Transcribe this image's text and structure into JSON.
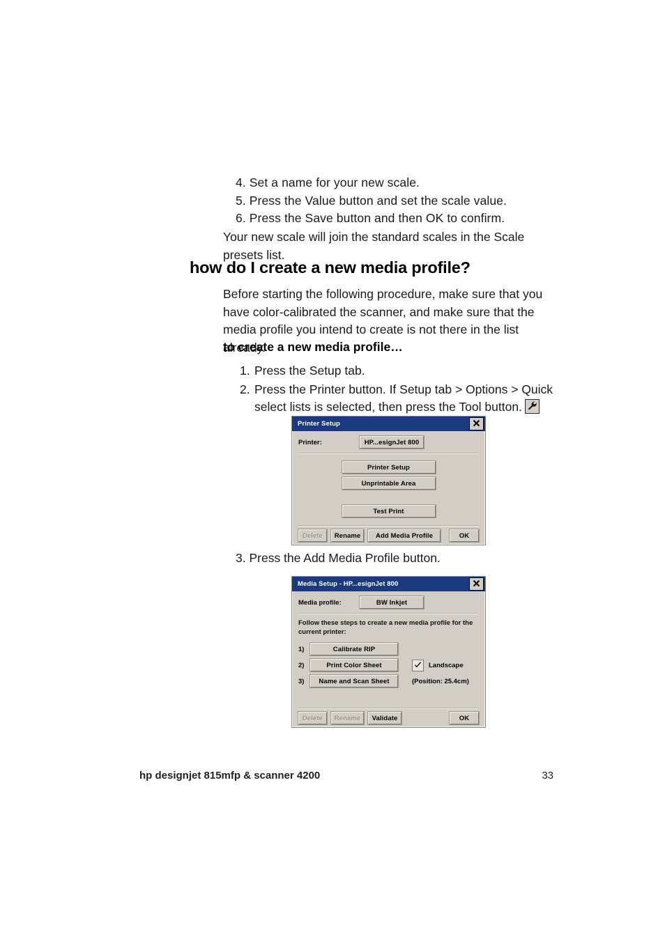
{
  "document": {
    "steps_top": [
      "4. Set a name for your new scale.",
      "5. Press the Value button and set the scale value.",
      "6. Press the Save button and then OK to confirm."
    ],
    "follow_up": "Your new scale will join the standard scales in the Scale presets list.",
    "heading": "how do I create a new media profile?",
    "intro": "Before starting the following procedure, make sure that you have color-calibrated the scanner, and make sure that the media profile you intend to create is not there in the list already.",
    "subheading": "to create a new media profile…",
    "step1_num": "1.",
    "step1_text": "Press the Setup tab.",
    "step2_num": "2.",
    "step2_text": "Press the Printer button. If Setup tab > Options > Quick select lists is selected, then press the Tool button.",
    "tool_icon": "wrench-icon",
    "step3": "3. Press the Add Media Profile button."
  },
  "printer_dialog": {
    "title": "Printer Setup",
    "close_icon": "close-icon",
    "printer_label": "Printer:",
    "printer_value": "HP...esignJet 800",
    "buttons": {
      "printer_setup": "Printer Setup",
      "unprintable_area": "Unprintable Area",
      "test_print": "Test Print",
      "delete": "Delete",
      "rename": "Rename",
      "add_media_profile": "Add Media Profile",
      "ok": "OK"
    }
  },
  "media_dialog": {
    "title": "Media Setup - HP...esignJet 800",
    "close_icon": "close-icon",
    "profile_label": "Media profile:",
    "profile_value": "BW Inkjet",
    "instructions": "Follow these steps to create a new media profile for the current printer:",
    "steps": [
      {
        "num": "1)",
        "label": "Calibrate RIP"
      },
      {
        "num": "2)",
        "label": "Print Color Sheet"
      },
      {
        "num": "3)",
        "label": "Name and Scan Sheet"
      }
    ],
    "landscape_label": "Landscape",
    "landscape_checked": true,
    "position_note": "(Position: 25.4cm)",
    "buttons": {
      "delete": "Delete",
      "rename": "Rename",
      "validate": "Validate",
      "ok": "OK"
    }
  },
  "footer": {
    "title": "hp designjet 815mfp & scanner 4200",
    "page_number": "33"
  },
  "colors": {
    "titlebar": "#1b3a7d",
    "dialog_face": "#d2cec6",
    "page_background": "#ffffff"
  }
}
